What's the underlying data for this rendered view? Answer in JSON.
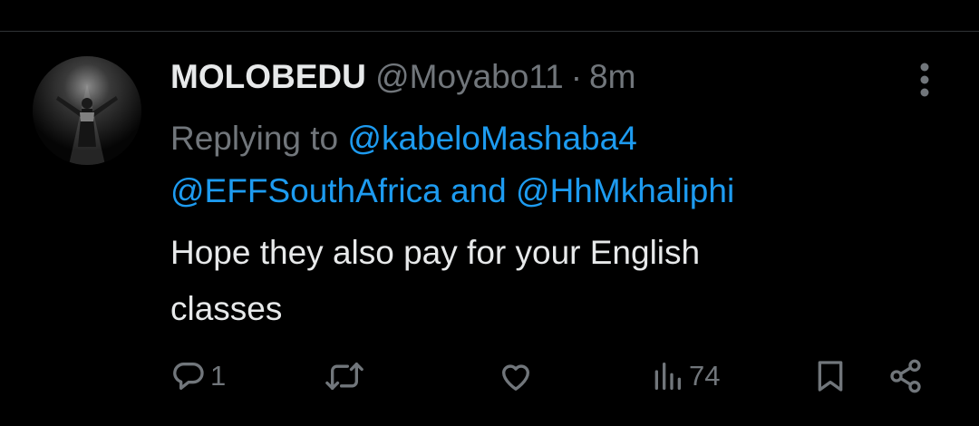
{
  "tweet": {
    "author_name": "MOLOBEDU",
    "author_handle": "@Moyabo11",
    "separator": "·",
    "time": "8m",
    "replying_prefix": "Replying to",
    "reply_mention_1": "@kabeloMashaba4",
    "reply_mention_2": "@EFFSouthAfrica",
    "reply_and": "and",
    "reply_mention_3": "@HhMkhaliphi",
    "text_line_1": "Hope they also pay for your English",
    "text_line_2": "classes"
  },
  "actions": {
    "reply_count": "1",
    "retweet_count": "",
    "like_count": "",
    "views_count": "74"
  },
  "icons": [
    "more-icon",
    "reply-icon",
    "retweet-icon",
    "like-icon",
    "views-icon",
    "bookmark-icon",
    "share-icon"
  ],
  "colors": {
    "background": "#000000",
    "primary_text": "#e7e9ea",
    "secondary_text": "#71767b",
    "link": "#1d9bf0"
  }
}
